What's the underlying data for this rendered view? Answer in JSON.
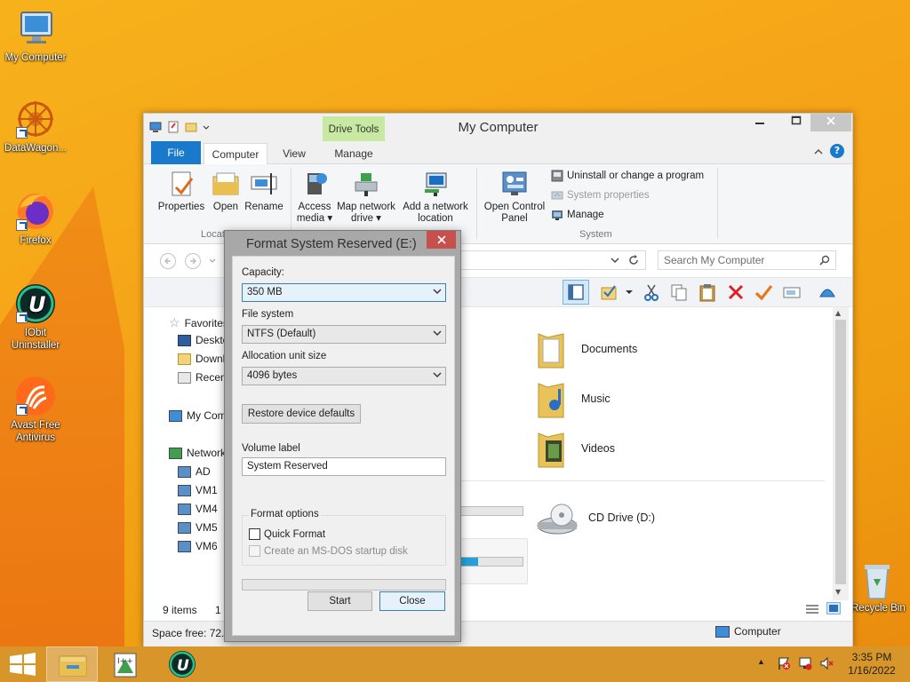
{
  "desktop": {
    "icons": [
      {
        "label": "My Computer",
        "icon": "computer-icon"
      },
      {
        "label": "DataWagon...",
        "icon": "datawagon-icon"
      },
      {
        "label": "Firefox",
        "icon": "firefox-icon"
      },
      {
        "label": "IObit Uninstaller",
        "icon": "iobit-icon"
      },
      {
        "label": "Avast Free Antivirus",
        "icon": "avast-icon"
      }
    ],
    "recycle_bin": "Recycle Bin"
  },
  "explorer": {
    "title": "My Computer",
    "context_tab": "Drive Tools",
    "tabs": [
      "File",
      "Computer",
      "View",
      "Manage"
    ],
    "ribbon": {
      "location_buttons": [
        "Properties",
        "Open",
        "Rename"
      ],
      "location_group": "Location",
      "network_buttons": [
        {
          "line1": "Access",
          "line2": "media ▾"
        },
        {
          "line1": "Map network",
          "line2": "drive ▾"
        },
        {
          "line1": "Add a network",
          "line2": "location"
        }
      ],
      "open_control_panel": {
        "line1": "Open Control",
        "line2": "Panel"
      },
      "system_items": [
        "Uninstall or change a program",
        "System properties",
        "Manage"
      ],
      "system_group": "System"
    },
    "search_placeholder": "Search My Computer",
    "nav": {
      "favorites": "Favorites",
      "fav_items": [
        "Desktop",
        "Downloads",
        "Recent places"
      ],
      "computer": "My Computer",
      "network": "Network",
      "network_items": [
        "AD",
        "VM1",
        "VM4",
        "VM5",
        "VM6"
      ]
    },
    "folders": [
      "Documents",
      "Music",
      "Videos"
    ],
    "cd_drive": "CD Drive (D:)",
    "status": {
      "items": "9 items",
      "selected": "1",
      "space_free": "Space free: 72.2",
      "location": "Computer"
    }
  },
  "format_dialog": {
    "title": "Format System Reserved (E:)",
    "capacity_label": "Capacity:",
    "capacity_value": "350 MB",
    "filesystem_label": "File system",
    "filesystem_value": "NTFS (Default)",
    "allocation_label": "Allocation unit size",
    "allocation_value": "4096 bytes",
    "restore_button": "Restore device defaults",
    "volume_label_label": "Volume label",
    "volume_label_value": "System Reserved",
    "format_options_label": "Format options",
    "quick_format": "Quick Format",
    "msdos_disk": "Create an MS-DOS startup disk",
    "start_button": "Start",
    "close_button": "Close"
  },
  "taskbar": {
    "time": "3:35 PM",
    "date": "1/16/2022"
  }
}
